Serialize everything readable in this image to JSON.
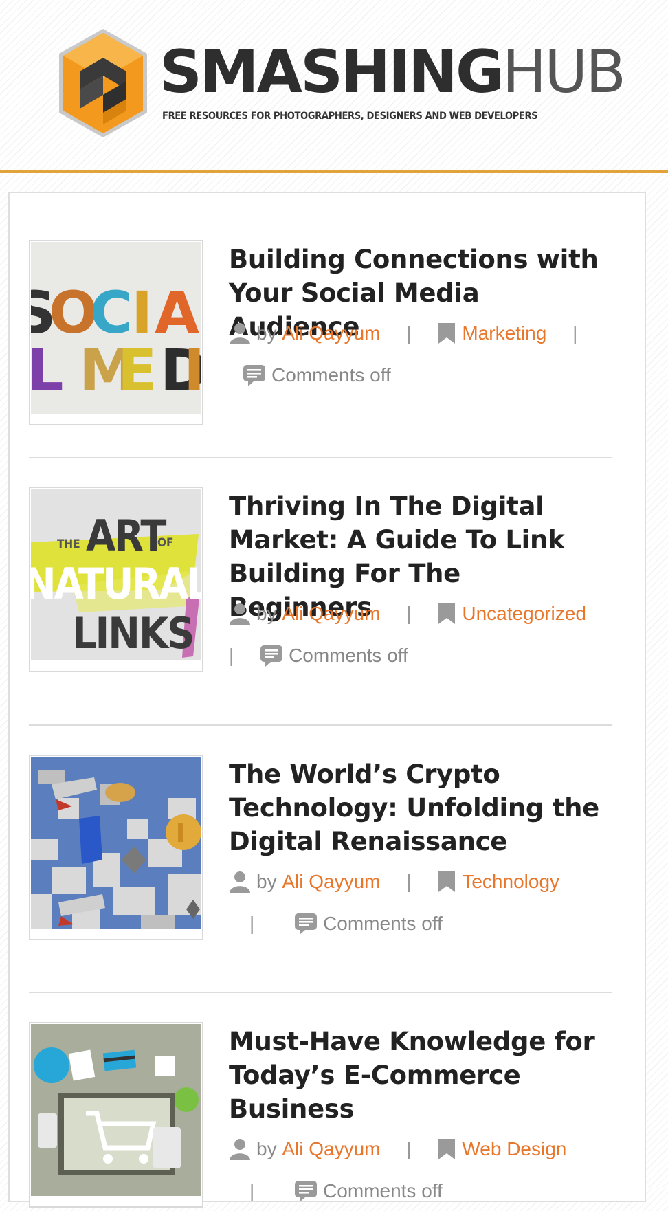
{
  "site": {
    "name_strong": "SMASHING",
    "name_light": "HUB",
    "tagline": "FREE RESOURCES FOR PHOTOGRAPHERS, DESIGNERS AND WEB DEVELOPERS",
    "colors": {
      "accent": "#e8762b",
      "header_rule": "#e3a33b",
      "logo_orange": "#f39a1e",
      "logo_dark": "#3a3a3a"
    }
  },
  "labels": {
    "by": "by",
    "separator": "|"
  },
  "posts": [
    {
      "title": "Building Connections with Your Social Media Audience",
      "author": "Ali Qayyum",
      "category": "Marketing",
      "comments": "Comments off",
      "thumb": {
        "line1": "SOCIAL",
        "line2": "MEDIA"
      }
    },
    {
      "title": "Thriving In The Digital Market: A Guide To Link Building For The Beginners",
      "author": "Ali Qayyum",
      "category": "Uncategorized",
      "comments": "Comments off",
      "thumb": {
        "the": "THE",
        "art": "ART",
        "of": "OF",
        "natural": "NATURAL",
        "links": "LINKS"
      }
    },
    {
      "title": "The World’s Crypto Technology: Unfolding the Digital Renaissance",
      "author": "Ali Qayyum",
      "category": "Technology",
      "comments": "Comments off",
      "thumb": {}
    },
    {
      "title": "Must-Have Knowledge for Today’s E-Commerce Business",
      "author": "Ali Qayyum",
      "category": "Web Design",
      "comments": "Comments off",
      "thumb": {}
    }
  ],
  "icons": {
    "author": "user-icon",
    "category": "bookmark-icon",
    "comments": "comment-icon"
  }
}
